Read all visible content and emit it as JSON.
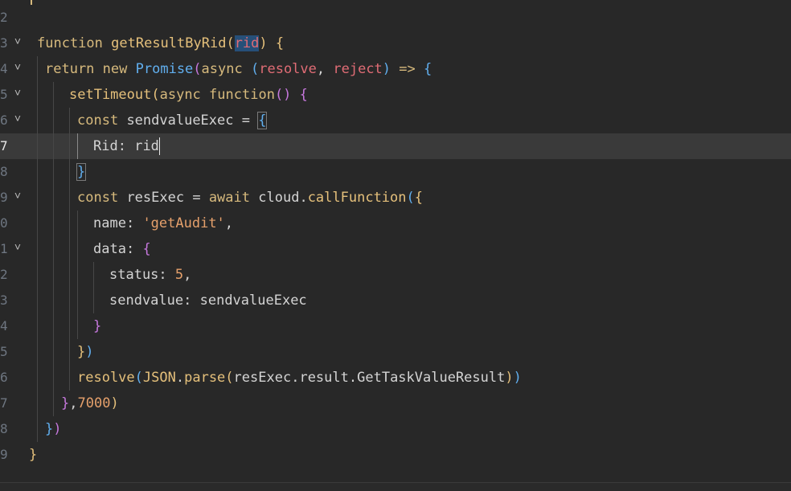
{
  "editor": {
    "lines": [
      {
        "num": "2",
        "folded": false
      },
      {
        "num": "3",
        "folded": true
      },
      {
        "num": "4",
        "folded": true
      },
      {
        "num": "5",
        "folded": true
      },
      {
        "num": "6",
        "folded": true
      },
      {
        "num": "7",
        "folded": false,
        "current": true
      },
      {
        "num": "8",
        "folded": false
      },
      {
        "num": "9",
        "folded": true
      },
      {
        "num": "0",
        "folded": false
      },
      {
        "num": "1",
        "folded": true
      },
      {
        "num": "2",
        "folded": false
      },
      {
        "num": "3",
        "folded": false
      },
      {
        "num": "4",
        "folded": false
      },
      {
        "num": "5",
        "folded": false
      },
      {
        "num": "6",
        "folded": false
      },
      {
        "num": "7",
        "folded": false
      },
      {
        "num": "8",
        "folded": false
      },
      {
        "num": "9",
        "folded": false
      }
    ],
    "fold_glyph": "˅",
    "tokens": {
      "function": "function",
      "getResultByRid": "getResultByRid",
      "rid": "rid",
      "return": "return",
      "new": "new",
      "Promise": "Promise",
      "async": "async",
      "resolve": "resolve",
      "reject": "reject",
      "arrow": "=>",
      "setTimeout": "setTimeout",
      "const": "const",
      "sendvalueExec": "sendvalueExec",
      "Rid": "Rid",
      "resExec": "resExec",
      "await": "await",
      "cloud": "cloud",
      "callFunction": "callFunction",
      "name": "name",
      "getAudit": "'getAudit'",
      "data": "data",
      "status": "status",
      "five": "5",
      "sendvalue": "sendvalue",
      "JSON": "JSON",
      "parse": "parse",
      "result": "result",
      "GetTaskValueResult": "GetTaskValueResult",
      "delay": "7000"
    }
  }
}
